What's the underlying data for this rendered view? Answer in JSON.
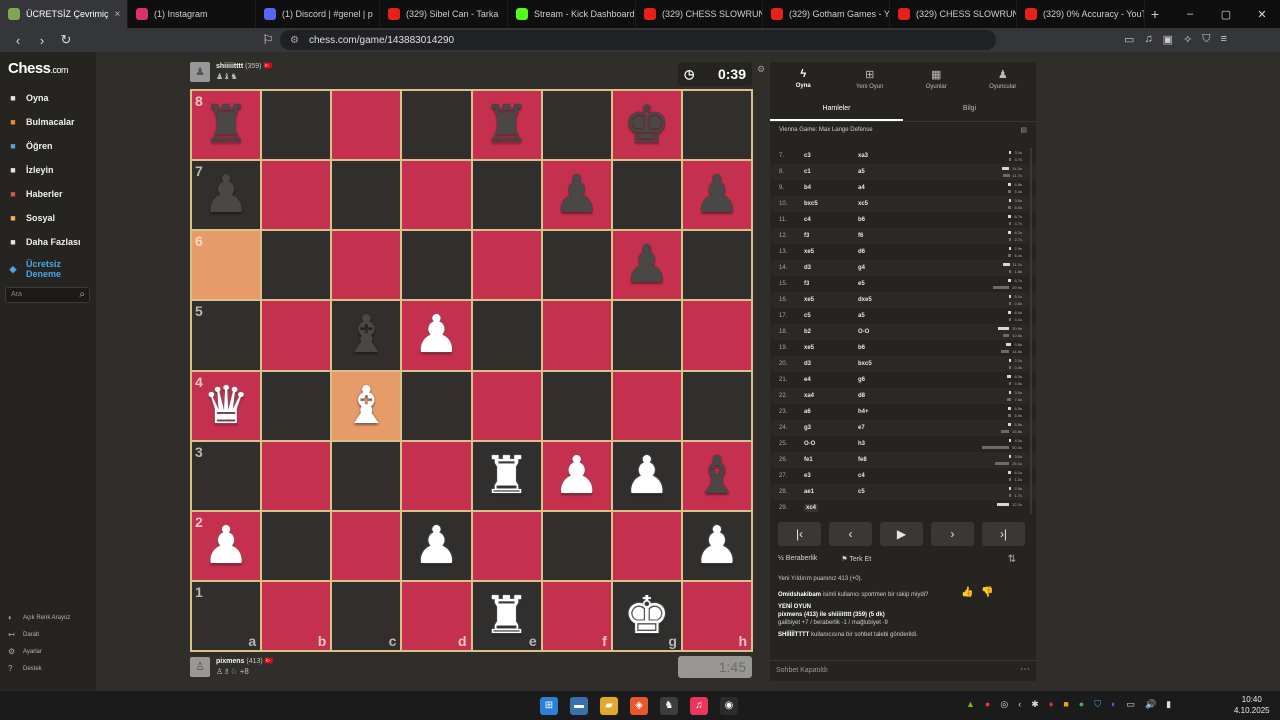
{
  "browser": {
    "tabs": [
      {
        "label": "ÜCRETSİZ Çevrimiç",
        "icon": "chess-favicon",
        "color": "#7fa650",
        "active": true
      },
      {
        "label": "(1) Instagram",
        "icon": "instagram-favicon",
        "color": "#d6336c",
        "active": false
      },
      {
        "label": "(1) Discord | #genel | p",
        "icon": "discord-favicon",
        "color": "#5865f2",
        "active": false
      },
      {
        "label": "(329) Sibel Can - Tarka",
        "icon": "youtube-favicon",
        "color": "#e62117",
        "active": false
      },
      {
        "label": "Stream - Kick Dashboard",
        "icon": "kick-favicon",
        "color": "#53fc18",
        "active": false
      },
      {
        "label": "(329) CHESS SLOWRUN E",
        "icon": "youtube-favicon",
        "color": "#e62117",
        "active": false
      },
      {
        "label": "(329) Gotham Games - Yo",
        "icon": "youtube-favicon",
        "color": "#e62117",
        "active": false
      },
      {
        "label": "(329) CHESS SLOWRUN (",
        "icon": "youtube-favicon",
        "color": "#e62117",
        "active": false
      },
      {
        "label": "(329) 0% Accuracy - YouTu",
        "icon": "youtube-favicon",
        "color": "#e62117",
        "active": false
      }
    ],
    "url": "chess.com/game/143883014290"
  },
  "sidebar": {
    "logo_main": "Chess",
    "logo_suffix": ".com",
    "items": [
      {
        "label": "Oyna",
        "icon": "pawn-play-icon",
        "color": "#e8e6e3"
      },
      {
        "label": "Bulmacalar",
        "icon": "puzzle-icon",
        "color": "#f38a2a"
      },
      {
        "label": "Öğren",
        "icon": "learn-icon",
        "color": "#47a5e8"
      },
      {
        "label": "İzleyin",
        "icon": "binoculars-icon",
        "color": "#e8e6e3"
      },
      {
        "label": "Haberler",
        "icon": "news-icon",
        "color": "#d9534f"
      },
      {
        "label": "Sosyal",
        "icon": "social-icon",
        "color": "#f0b455"
      },
      {
        "label": "Daha Fazlası",
        "icon": "more-icon",
        "color": "#e8e6e3"
      }
    ],
    "trial_line1": "Ücretsiz",
    "trial_line2": "Deneme",
    "search_placeholder": "Ara",
    "bottom": [
      "Açık Renk Arayüz",
      "Daralt",
      "Ayarlar",
      "Destek"
    ]
  },
  "players": {
    "top": {
      "name": "shiiiiitttt",
      "rating": "(359)",
      "flag": "🇹🇷",
      "captured": "♟♝♞"
    },
    "bottom": {
      "name": "pixmens",
      "rating": "(413)",
      "flag": "🇹🇷",
      "captured": "♙♗♘ +8"
    }
  },
  "clocks": {
    "top": "0:39",
    "bottom": "1:45"
  },
  "board": {
    "ranks": [
      "8",
      "7",
      "6",
      "5",
      "4",
      "3",
      "2",
      "1"
    ],
    "files": [
      "a",
      "b",
      "c",
      "d",
      "e",
      "f",
      "g",
      "h"
    ],
    "squares": [
      [
        "♜",
        "",
        "",
        "",
        "♜",
        "",
        "♚",
        ""
      ],
      [
        "♟",
        "",
        "",
        "",
        "",
        "♟",
        "",
        "♟"
      ],
      [
        "",
        "",
        "",
        "",
        "",
        "",
        "♟",
        ""
      ],
      [
        "",
        "",
        "♝",
        "♙",
        "",
        "",
        "",
        ""
      ],
      [
        "♕",
        "",
        "♗",
        "",
        "",
        "",
        "",
        ""
      ],
      [
        "",
        "",
        "",
        "",
        "♖",
        "♙",
        "♙",
        "♝"
      ],
      [
        "♙",
        "",
        "",
        "♙",
        "",
        "",
        "",
        "♙"
      ],
      [
        "",
        "",
        "",
        "",
        "♖",
        "",
        "♔",
        ""
      ]
    ],
    "highlight": [
      "a6",
      "c4"
    ],
    "light_color": "#c6304f",
    "dark_color": "#312f2d",
    "highlight_color": "#e79b69"
  },
  "panel": {
    "tabs": [
      {
        "label": "Oyna",
        "icon": "lightning-icon"
      },
      {
        "label": "Yeni Oyun",
        "icon": "plus-icon"
      },
      {
        "label": "Oyunlar",
        "icon": "grid-icon"
      },
      {
        "label": "Oyuncular",
        "icon": "players-icon"
      }
    ],
    "subtabs": [
      "Hamleler",
      "Bilgi"
    ],
    "opening": "Vienna Game: Max Lange Defense",
    "moves": [
      {
        "no": "7.",
        "w": "c3",
        "b": "xa3",
        "wt": "3.0s",
        "bt": "3.7s"
      },
      {
        "no": "8.",
        "w": "c1",
        "b": "a5",
        "wt": "14.0s",
        "bt": "11.7s"
      },
      {
        "no": "9.",
        "w": "b4",
        "b": "a4",
        "wt": "6.8s",
        "bt": "5.4s"
      },
      {
        "no": "10.",
        "w": "bxc5",
        "b": "xc5",
        "wt": "3.6s",
        "bt": "6.0s"
      },
      {
        "no": "11.",
        "w": "c4",
        "b": "b6",
        "wt": "6.7s",
        "bt": "4.7s"
      },
      {
        "no": "12.",
        "w": "f3",
        "b": "f6",
        "wt": "6.2s",
        "bt": "2.7s"
      },
      {
        "no": "13.",
        "w": "xe5",
        "b": "d6",
        "wt": "2.9s",
        "bt": "6.4s"
      },
      {
        "no": "14.",
        "w": "d3",
        "b": "g4",
        "wt": "11.1s",
        "bt": "1.8s"
      },
      {
        "no": "15.",
        "w": "f3",
        "b": "e5",
        "wt": "6.7s",
        "bt": "29.9s"
      },
      {
        "no": "16.",
        "w": "xe5",
        "b": "dxe5",
        "wt": "5.1s",
        "bt": "0.8s"
      },
      {
        "no": "17.",
        "w": "c5",
        "b": "a5",
        "wt": "6.4s",
        "bt": "4.1s"
      },
      {
        "no": "18.",
        "w": "b2",
        "b": "O-O",
        "wt": "20.9s",
        "bt": "10.5s"
      },
      {
        "no": "19.",
        "w": "xe5",
        "b": "b6",
        "wt": "9.8s",
        "bt": "14.8s"
      },
      {
        "no": "20.",
        "w": "d3",
        "b": "bxc5",
        "wt": "2.2s",
        "bt": "0.4s"
      },
      {
        "no": "21.",
        "w": "e4",
        "b": "g6",
        "wt": "8.3s",
        "bt": "4.5s"
      },
      {
        "no": "22.",
        "w": "xa4",
        "b": "d8",
        "wt": "3.0s",
        "bt": "7.6s"
      },
      {
        "no": "23.",
        "w": "a6",
        "b": "h4+",
        "wt": "6.5s",
        "bt": "6.5s"
      },
      {
        "no": "24.",
        "w": "g3",
        "b": "e7",
        "wt": "5.5s",
        "bt": "15.8s"
      },
      {
        "no": "25.",
        "w": "O-O",
        "b": "h3",
        "wt": "4.0s",
        "bt": "50.3s"
      },
      {
        "no": "26.",
        "w": "fe1",
        "b": "fe8",
        "wt": "3.0s",
        "bt": "26.1s"
      },
      {
        "no": "27.",
        "w": "e3",
        "b": "c4",
        "wt": "6.1s",
        "bt": "1.2s"
      },
      {
        "no": "28.",
        "w": "ae1",
        "b": "c5",
        "wt": "2.5s",
        "bt": "1.7s"
      },
      {
        "no": "29.",
        "w": "xc4",
        "b": "",
        "wt": "22.2s",
        "bt": ""
      }
    ],
    "draw_label": "Beraberlik",
    "resign_label": "Terk Et",
    "chat": {
      "rating_line": "Yeni Yıldırım puanınız 413 (+0).",
      "sportsman_q_user": "Omidshakibam",
      "sportsman_q_rest": " isimli kullanıcı sportmen bir rakip miydi?",
      "new_game_title": "YENİ OYUN",
      "new_game_line": "pixmens (413) ile shiiiiitttt (359) (5 dk)",
      "result_line": "galibiyet +7 / beraberlik -1 / mağlubiyet -9",
      "request_user": "SHİİİİİTTTT",
      "request_rest": " kullanıcısına bir sohbet talebi gönderildi."
    },
    "chat_placeholder": "Sohbet Kapatıldı"
  },
  "taskbar": {
    "time": "10:40",
    "date": "4.10.2025"
  }
}
